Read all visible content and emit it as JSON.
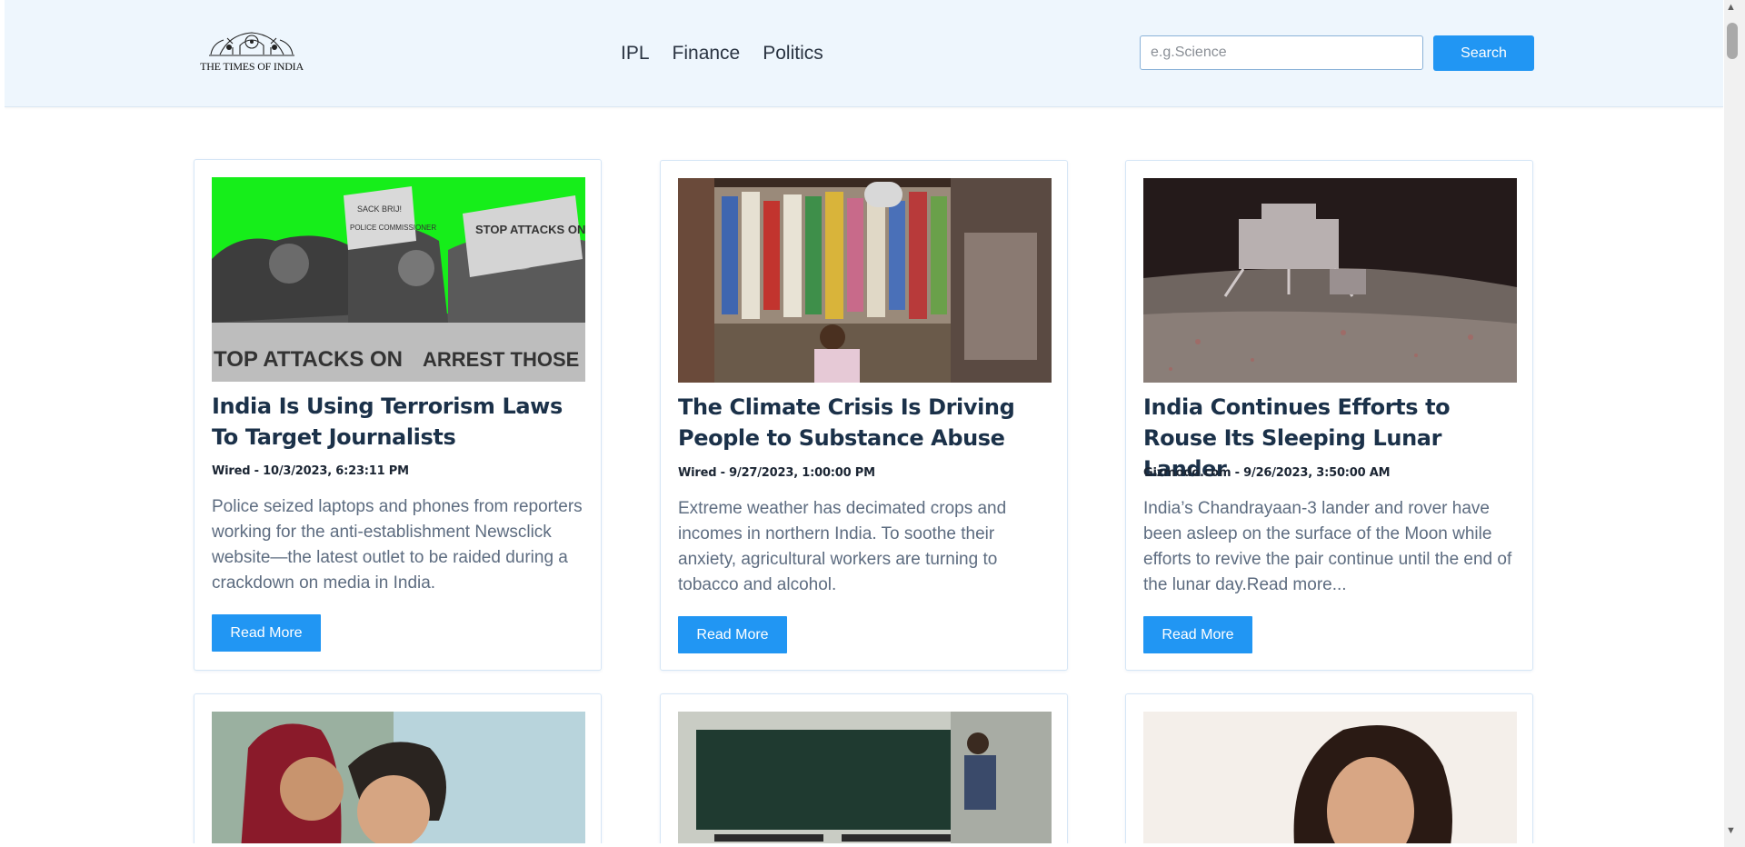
{
  "header": {
    "logo_text": "THE TIMES OF INDIA",
    "nav": [
      "IPL",
      "Finance",
      "Politics"
    ],
    "search_placeholder": "e.g.Science",
    "search_value": "",
    "search_button": "Search"
  },
  "articles": [
    {
      "title": "India Is Using Terrorism Laws To Target Journalists",
      "meta": "Wired - 10/3/2023, 6:23:11 PM",
      "description": "Police seized laptops and phones from reporters working for the anti-establishment Newsclick website—the latest outlet to be raided during a crackdown on media in India.",
      "button": "Read More",
      "image_signs": [
        "SACK BRIJ!",
        "POLICE COMMISSIONER",
        "STOP ATTACKS ON JOURNALISTS!",
        "TOP ATTACKS ON",
        "ARREST THOSE"
      ]
    },
    {
      "title": "The Climate Crisis Is Driving People to Substance Abuse",
      "meta": "Wired - 9/27/2023, 1:00:00 PM",
      "description": "Extreme weather has decimated crops and incomes in northern India. To soothe their anxiety, agricultural workers are turning to tobacco and alcohol.",
      "button": "Read More"
    },
    {
      "title": "India Continues Efforts to Rouse Its Sleeping Lunar Lander",
      "meta": "Gizmodo.com - 9/26/2023, 3:50:00 AM",
      "description": "India’s Chandrayaan-3 lander and rover have been asleep on the surface of the Moon while efforts to revive the pair continue until the end of the lunar day.Read more...",
      "button": "Read More"
    }
  ],
  "colors": {
    "header_bg": "#eef6fd",
    "accent": "#2196f3",
    "title": "#1b3149",
    "description": "#5d6c80"
  }
}
